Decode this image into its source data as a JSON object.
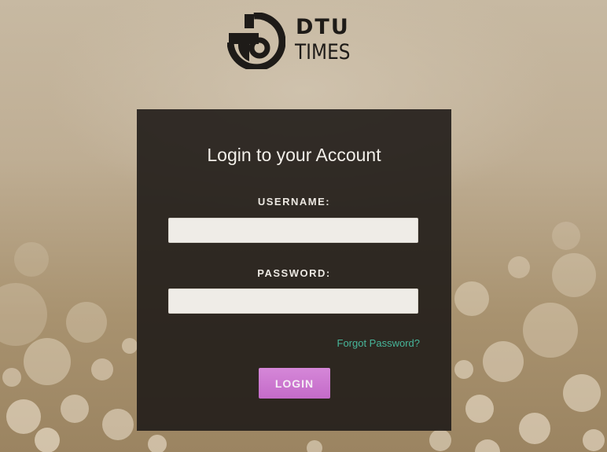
{
  "brand": {
    "line1": "DTU",
    "line2": "TIMES",
    "logo_icon": "dtu-times-logo-mark"
  },
  "login": {
    "title": "Login to your Account",
    "username_label": "USERNAME:",
    "username_value": "",
    "password_label": "PASSWORD:",
    "password_value": "",
    "forgot_label": "Forgot Password?",
    "button_label": "LOGIN"
  },
  "colors": {
    "panel_bg": "#201c18",
    "accent_link": "#47b69a",
    "button": "#c879cb",
    "background": "#bfae94"
  }
}
